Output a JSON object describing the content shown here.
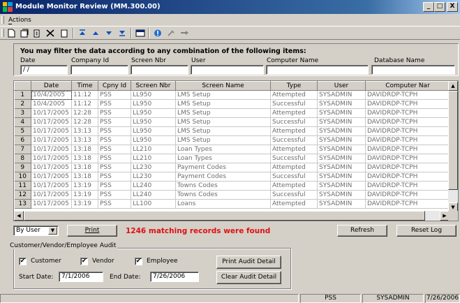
{
  "window": {
    "title": "Module Monitor Review (MM.300.00)",
    "min": "_",
    "max": "□",
    "close": "X"
  },
  "menu": {
    "actions": "Actions"
  },
  "toolbar": [
    "new-icon",
    "save-icon",
    "copy-icon",
    "delete-icon",
    "clipboard-icon",
    "first-record-icon",
    "previous-record-icon",
    "next-record-icon",
    "last-record-icon",
    "window-icon",
    "help-icon",
    "tools-icon",
    "navigate-icon"
  ],
  "filter": {
    "heading": "You may filter the data according to any combination of the following items:",
    "date": {
      "label": "Date",
      "value": " / /"
    },
    "company": {
      "label": "Company Id",
      "value": ""
    },
    "screen": {
      "label": "Screen Nbr",
      "value": ""
    },
    "user": {
      "label": "User",
      "value": ""
    },
    "computer": {
      "label": "Computer Name",
      "value": ""
    },
    "database": {
      "label": "Database Name",
      "value": ""
    }
  },
  "grid": {
    "columns": [
      "",
      "Date",
      "Time",
      "Cpny Id",
      "Screen Nbr",
      "Screen Name",
      "Type",
      "User",
      "Computer Nar"
    ],
    "rows": [
      [
        "1",
        "10/4/2005",
        "11:12",
        "PSS",
        "LL950",
        "LMS Setup",
        "Attempted",
        "SYSADMIN",
        "DAVIDRDP-TCPH"
      ],
      [
        "2",
        "10/4/2005",
        "11:12",
        "PSS",
        "LL950",
        "LMS Setup",
        "Successful",
        "SYSADMIN",
        "DAVIDRDP-TCPH"
      ],
      [
        "3",
        "10/17/2005",
        "12:28",
        "PSS",
        "LL950",
        "LMS Setup",
        "Attempted",
        "SYSADMIN",
        "DAVIDRDP-TCPH"
      ],
      [
        "4",
        "10/17/2005",
        "12:28",
        "PSS",
        "LL950",
        "LMS Setup",
        "Successful",
        "SYSADMIN",
        "DAVIDRDP-TCPH"
      ],
      [
        "5",
        "10/17/2005",
        "13:13",
        "PSS",
        "LL950",
        "LMS Setup",
        "Attempted",
        "SYSADMIN",
        "DAVIDRDP-TCPH"
      ],
      [
        "6",
        "10/17/2005",
        "13:13",
        "PSS",
        "LL950",
        "LMS Setup",
        "Successful",
        "SYSADMIN",
        "DAVIDRDP-TCPH"
      ],
      [
        "7",
        "10/17/2005",
        "13:18",
        "PSS",
        "LL210",
        "Loan Types",
        "Attempted",
        "SYSADMIN",
        "DAVIDRDP-TCPH"
      ],
      [
        "8",
        "10/17/2005",
        "13:18",
        "PSS",
        "LL210",
        "Loan Types",
        "Successful",
        "SYSADMIN",
        "DAVIDRDP-TCPH"
      ],
      [
        "9",
        "10/17/2005",
        "13:18",
        "PSS",
        "LL230",
        "Payment Codes",
        "Attempted",
        "SYSADMIN",
        "DAVIDRDP-TCPH"
      ],
      [
        "10",
        "10/17/2005",
        "13:18",
        "PSS",
        "LL230",
        "Payment Codes",
        "Successful",
        "SYSADMIN",
        "DAVIDRDP-TCPH"
      ],
      [
        "11",
        "10/17/2005",
        "13:19",
        "PSS",
        "LL240",
        "Towns Codes",
        "Attempted",
        "SYSADMIN",
        "DAVIDRDP-TCPH"
      ],
      [
        "12",
        "10/17/2005",
        "13:19",
        "PSS",
        "LL240",
        "Towns Codes",
        "Successful",
        "SYSADMIN",
        "DAVIDRDP-TCPH"
      ],
      [
        "13",
        "10/17/2005",
        "13:19",
        "PSS",
        "LL100",
        "Loans",
        "Attempted",
        "SYSADMIN",
        "DAVIDRDP-TCPH"
      ]
    ]
  },
  "controls": {
    "sort_by": "By User",
    "print": "Print",
    "matching": "1246 matching records were found",
    "refresh": "Refresh",
    "reset_log": "Reset Log"
  },
  "audit": {
    "title": "Customer/Vendor/Employee Audit",
    "customer": "Customer",
    "vendor": "Vendor",
    "employee": "Employee",
    "check": "✔",
    "start_label": "Start Date:",
    "start_value": "7/1/2006",
    "end_label": "End Date:",
    "end_value": "7/26/2006",
    "print_detail": "Print Audit Detail",
    "clear_detail": "Clear Audit Detail"
  },
  "status": {
    "company": "PSS",
    "user": "SYSADMIN",
    "date": "7/26/2006"
  },
  "colors": {
    "titlebar": "#0a246a",
    "matching": "#e01010",
    "face": "#d4d0c8"
  }
}
